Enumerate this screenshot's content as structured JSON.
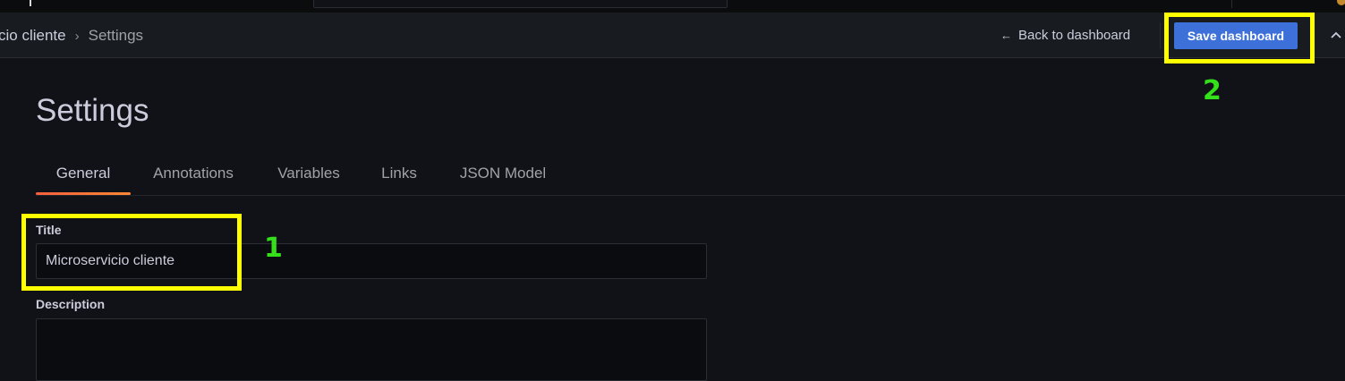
{
  "breadcrumb": {
    "parent": "cio cliente",
    "separator": "›",
    "current": "Settings"
  },
  "toolbar": {
    "back_arrow": "←",
    "back_label": "Back to dashboard",
    "save_label": "Save dashboard",
    "collapse_icon": "chevron-up-icon"
  },
  "page": {
    "title": "Settings"
  },
  "tabs": [
    {
      "label": "General",
      "active": true
    },
    {
      "label": "Annotations",
      "active": false
    },
    {
      "label": "Variables",
      "active": false
    },
    {
      "label": "Links",
      "active": false
    },
    {
      "label": "JSON Model",
      "active": false
    }
  ],
  "form": {
    "title_label": "Title",
    "title_value": "Microservicio cliente",
    "description_label": "Description",
    "description_value": ""
  },
  "annotations": {
    "marker_1": "1",
    "marker_2": "2",
    "highlight_color": "#ffff00",
    "number_color": "#33e01a"
  },
  "colors": {
    "primary": "#3d71d9",
    "tab_underline": "#f55f3e",
    "background": "#111217"
  }
}
